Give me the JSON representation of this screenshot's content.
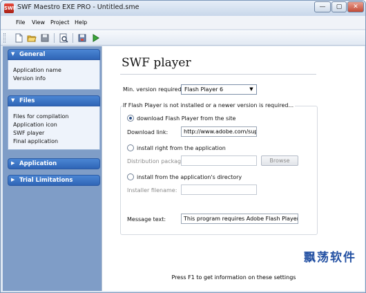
{
  "window": {
    "title": "SWF Maestro EXE PRO - Untitled.sme",
    "icon_text": "SWF",
    "buttons": {
      "minimize": "—",
      "maximize": "▢",
      "close": "✕"
    }
  },
  "menu": {
    "file": "File",
    "view": "View",
    "project": "Project",
    "help": "Help"
  },
  "toolbar": {
    "icons": [
      "new-file-icon",
      "open-folder-icon",
      "save-icon",
      "preview-icon",
      "build-icon",
      "run-icon"
    ]
  },
  "sidebar": {
    "general": {
      "label": "General",
      "links": [
        "Application name",
        "Version info"
      ]
    },
    "files": {
      "label": "Files",
      "links": [
        "Files for compilation",
        "Application icon",
        "SWF player",
        "Final application"
      ]
    },
    "application": {
      "label": "Application"
    },
    "trial": {
      "label": "Trial Limitations"
    }
  },
  "main": {
    "title": "SWF player",
    "min_version": {
      "label": "Min. version required:",
      "value": "Flash Player 6"
    },
    "group_caption": "If Flash Player is not installed or a newer version is required...",
    "option_download": {
      "label": "download Flash Player from the site",
      "selected": true
    },
    "download_link": {
      "label": "Download link:",
      "value": "http://www.adobe.com/supp"
    },
    "option_install_app": {
      "label": "install right from the application",
      "selected": false
    },
    "distribution": {
      "label": "Distribution package:",
      "value": "",
      "browse": "Browse"
    },
    "option_install_dir": {
      "label": "install from the application's directory",
      "selected": false
    },
    "installer": {
      "label": "Installer filename:",
      "value": ""
    },
    "message": {
      "label": "Message text:",
      "value": "This program requires Adobe Flash Player Activ"
    },
    "watermark": "飘荡软件",
    "status": "Press F1 to get information on these settings"
  },
  "colors": {
    "sidebar_bg": "#7f9dc7",
    "panel_header": "#3c74c6",
    "window_frame": "#dfe8f3"
  }
}
